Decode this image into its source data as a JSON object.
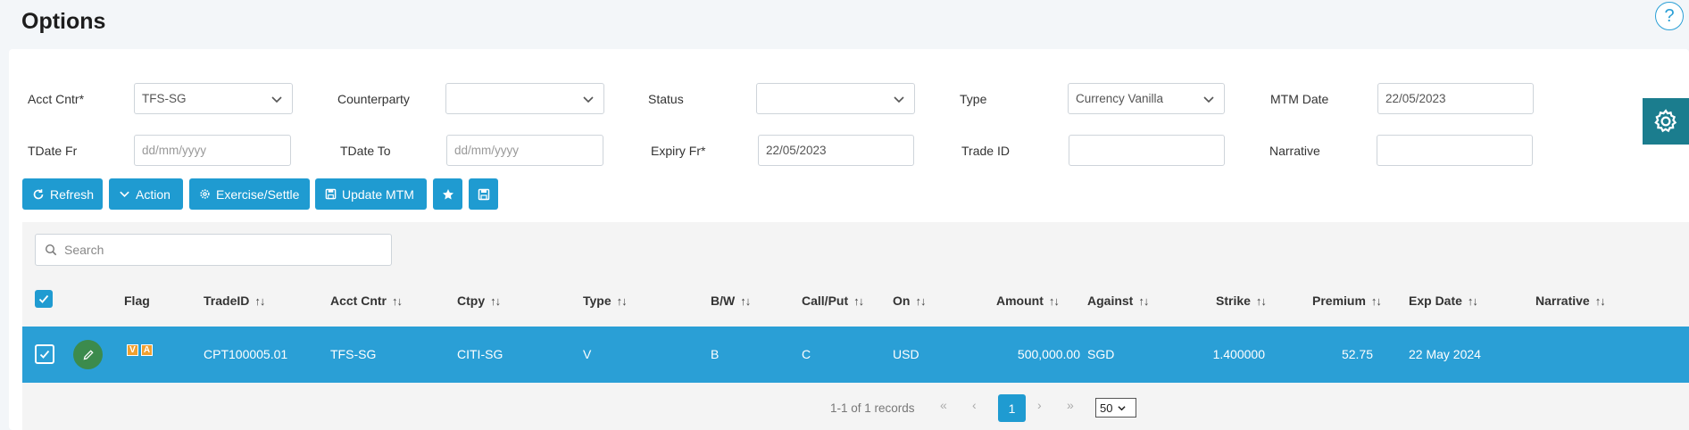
{
  "header": {
    "title": "Options",
    "help_label": "?"
  },
  "filters": {
    "acct_cntr": {
      "label": "Acct Cntr*",
      "value": "TFS-SG"
    },
    "counterparty": {
      "label": "Counterparty",
      "value": ""
    },
    "status": {
      "label": "Status",
      "value": ""
    },
    "type": {
      "label": "Type",
      "value": "Currency Vanilla"
    },
    "mtm_date": {
      "label": "MTM Date",
      "value": "22/05/2023"
    },
    "tdate_fr": {
      "label": "TDate Fr",
      "placeholder": "dd/mm/yyyy"
    },
    "tdate_to": {
      "label": "TDate To",
      "placeholder": "dd/mm/yyyy"
    },
    "expiry_fr": {
      "label": "Expiry Fr*",
      "value": "22/05/2023"
    },
    "trade_id": {
      "label": "Trade ID",
      "value": ""
    },
    "narrative": {
      "label": "Narrative",
      "value": ""
    }
  },
  "toolbar": {
    "refresh": "Refresh",
    "action": "Action",
    "exercise": "Exercise/Settle",
    "update_mtm": "Update MTM"
  },
  "grid": {
    "search_placeholder": "Search",
    "sort_glyph": "↑↓",
    "columns": {
      "flag": "Flag",
      "trade_id": "TradeID",
      "acct_cntr": "Acct Cntr",
      "ctpy": "Ctpy",
      "type": "Type",
      "bw": "B/W",
      "call_put": "Call/Put",
      "on": "On",
      "amount": "Amount",
      "against": "Against",
      "strike": "Strike",
      "premium": "Premium",
      "exp_date": "Exp Date",
      "narrative": "Narrative"
    },
    "rows": [
      {
        "flags": [
          "V",
          "A"
        ],
        "trade_id": "CPT100005.01",
        "acct_cntr": "TFS-SG",
        "ctpy": "CITI-SG",
        "type": "V",
        "bw": "B",
        "call_put": "C",
        "on": "USD",
        "amount": "500,000.00",
        "against": "SGD",
        "strike": "1.400000",
        "premium": "52.75",
        "exp_date": "22 May 2024",
        "narrative": ""
      }
    ]
  },
  "pagination": {
    "info": "1-1 of 1 records",
    "first": "«",
    "prev": "‹",
    "current": "1",
    "next": "›",
    "last": "»",
    "page_size": "50"
  },
  "colors": {
    "accent": "#1f9bd1",
    "row_selected": "#2a9fd6",
    "edit": "#3c8b4d",
    "settings": "#1b7d8e"
  }
}
